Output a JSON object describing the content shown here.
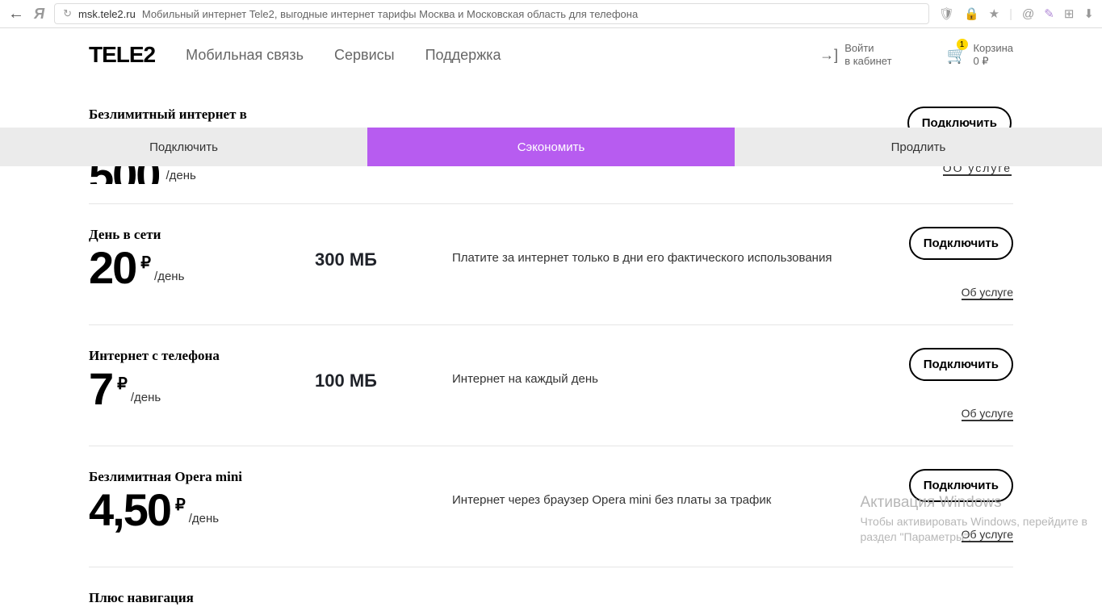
{
  "browser": {
    "host": "msk.tele2.ru",
    "title": "Мобильный интернет Tele2, выгодные интернет тарифы Москва и Московская область для телефона"
  },
  "header": {
    "logo": "TELE2",
    "nav": [
      "Мобильная связь",
      "Сервисы",
      "Поддержка"
    ],
    "login_l1": "Войти",
    "login_l2": "в кабинет",
    "cart_l1": "Корзина",
    "cart_l2": "0 ₽",
    "cart_badge": "1"
  },
  "tabs": [
    "Подключить",
    "Сэкономить",
    "Продлить"
  ],
  "cutoff": {
    "title": "Безлимитный интернет в",
    "price_visible": "500",
    "per": "/день",
    "connect": "Подключить",
    "about_fragment": "ОО услуге"
  },
  "tariffs": [
    {
      "title": "День в сети",
      "price": "20",
      "currency": "₽",
      "per": "/день",
      "amount": "300 МБ",
      "desc": "Платите за интернет только в дни его фактического использования",
      "connect": "Подключить",
      "about": "Об услуге"
    },
    {
      "title": "Интернет с телефона",
      "price": "7",
      "currency": "₽",
      "per": "/день",
      "amount": "100 МБ",
      "desc": "Интернет на каждый день",
      "connect": "Подключить",
      "about": "Об услуге"
    },
    {
      "title": "Безлимитная Opera mini",
      "price": "4,50",
      "currency": "₽",
      "per": "/день",
      "amount": "",
      "desc": "Интернет через браузер Opera mini без платы за трафик",
      "connect": "Подключить",
      "about": "Об услуге"
    },
    {
      "title": "Плюс навигация",
      "price": "",
      "currency": "",
      "per": "",
      "amount": "",
      "desc": "",
      "connect": "",
      "about": ""
    }
  ],
  "watermark": {
    "t1": "Активация Windows",
    "t2": "Чтобы активировать Windows, перейдите в",
    "t3": "раздел \"Параметры\"."
  }
}
